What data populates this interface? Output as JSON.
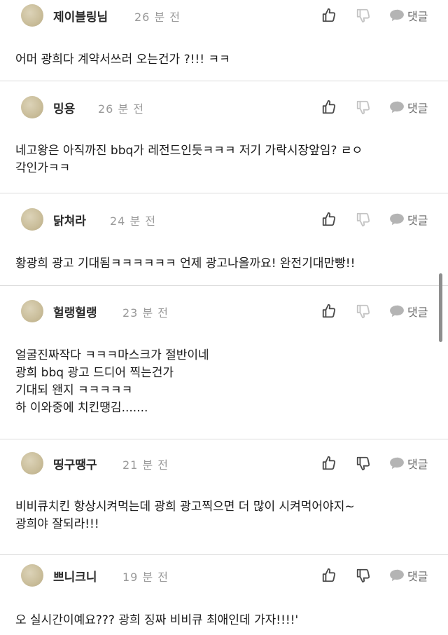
{
  "comments": [
    {
      "author": "제이블링님",
      "time": "26 분 전",
      "lines": [
        "어머 광희다 계약서쓰러 오는건가 ?!!! ㅋㅋ"
      ],
      "reply_label": "댓글"
    },
    {
      "author": "밍용",
      "time": "26 분 전",
      "lines": [
        "네고왕은 아직까진 bbq가 레전드인듯ㅋㅋㅋ 저기 가락시장앞임? ㄹㅇ",
        "각인가ㅋㅋ"
      ],
      "reply_label": "댓글"
    },
    {
      "author": "닭쳐라",
      "time": "24 분 전",
      "lines": [
        "황광희 광고 기대됨ㅋㅋㅋㅋㅋㅋ 언제 광고나올까요! 완전기대만빵!!"
      ],
      "reply_label": "댓글"
    },
    {
      "author": "헐랭헐랭",
      "time": "23 분 전",
      "lines": [
        "얼굴진짜작다 ㅋㅋㅋ마스크가 절반이네",
        "광희 bbq 광고 드디어 찍는건가",
        "기대되 왠지 ㅋㅋㅋㅋㅋ",
        "하 이와중에 치킨땡김......."
      ],
      "reply_label": "댓글"
    },
    {
      "author": "띵구땡구",
      "time": "21 분 전",
      "lines": [
        "비비큐치킨 항상시켜먹는데 광희 광고찍으면 더 많이 시켜먹어야지~",
        "광희야 잘되라!!!"
      ],
      "reply_label": "댓글"
    },
    {
      "author": "쁘니크니",
      "time": "19 분 전",
      "lines": [
        "오 실시간이예요??? 광희 징짜 비비큐 최애인데 가자!!!!'"
      ],
      "reply_label": "댓글"
    }
  ],
  "colors": {
    "avatar": "#cbbf9c",
    "divider": "#dcdcdc",
    "icon": "#8a8a8a",
    "icon_light": "#c4c4c4"
  }
}
